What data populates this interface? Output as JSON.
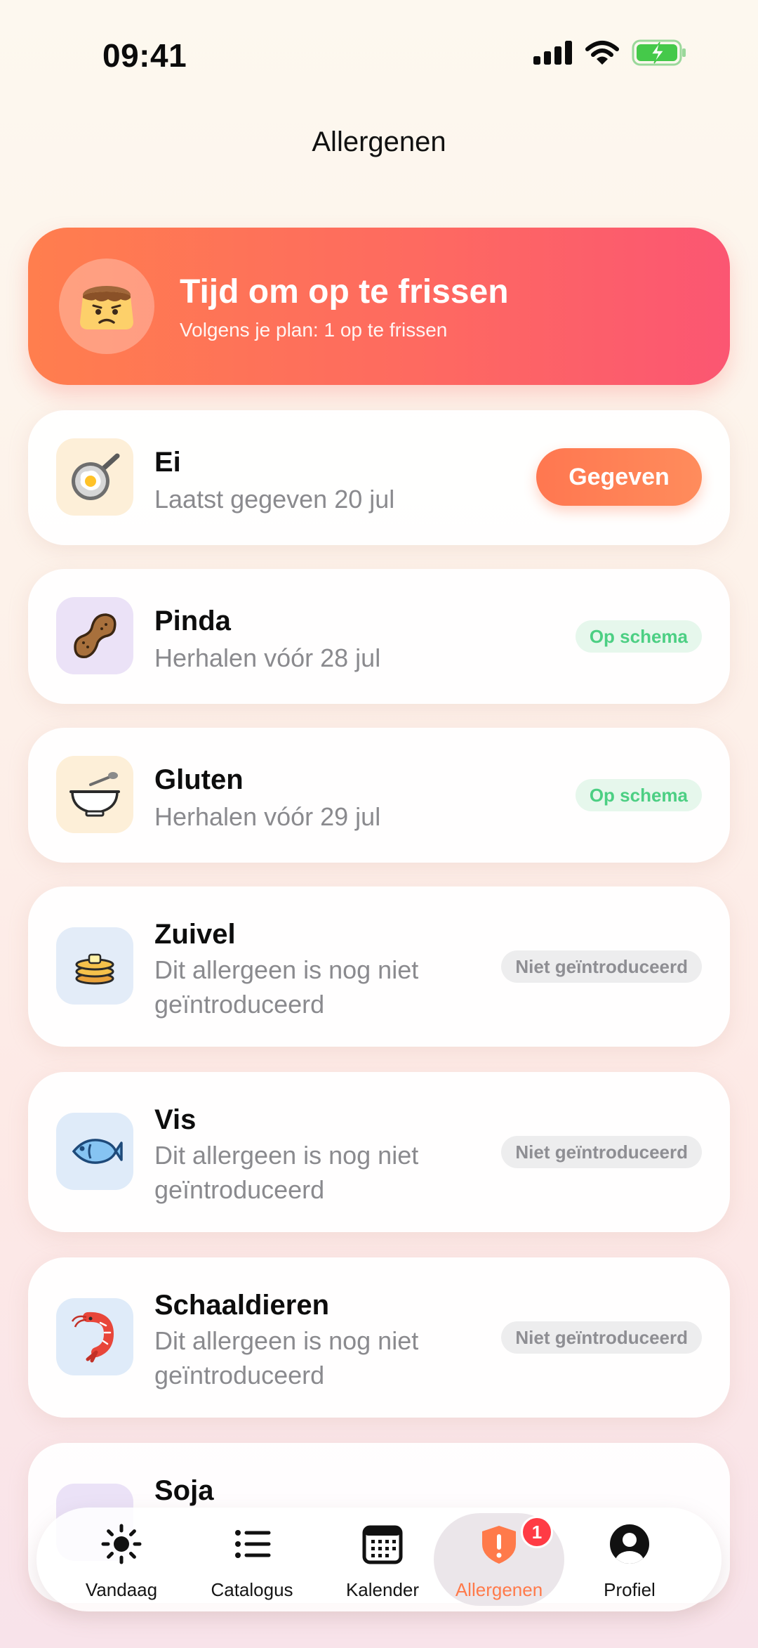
{
  "status": {
    "time": "09:41"
  },
  "header": {
    "title": "Allergenen"
  },
  "banner": {
    "title": "Tijd om op te frissen",
    "subtitle": "Volgens je plan: 1 op te frissen",
    "icon": "worried-pudding-icon"
  },
  "allergens": [
    {
      "name": "Ei",
      "subtitle": "Laatst gegeven 20 jul",
      "action_label": "Gegeven",
      "icon": "fried-egg-pan-icon"
    },
    {
      "name": "Pinda",
      "subtitle": "Herhalen vóór 28 jul",
      "status": "Op schema",
      "icon": "peanut-icon"
    },
    {
      "name": "Gluten",
      "subtitle": "Herhalen vóór 29 jul",
      "status": "Op schema",
      "icon": "cereal-bowl-icon"
    },
    {
      "name": "Zuivel",
      "subtitle": "Dit allergeen is nog niet geïntroduceerd",
      "status": "Niet geïntroduceerd",
      "icon": "pancakes-butter-icon"
    },
    {
      "name": "Vis",
      "subtitle": "Dit allergeen is nog niet geïntroduceerd",
      "status": "Niet geïntroduceerd",
      "icon": "fish-icon"
    },
    {
      "name": "Schaaldieren",
      "subtitle": "Dit allergeen is nog niet geïntroduceerd",
      "status": "Niet geïntroduceerd",
      "icon": "shrimp-icon"
    },
    {
      "name": "Soja",
      "icon": "soybean-icon"
    }
  ],
  "tabs": [
    {
      "label": "Vandaag",
      "icon": "sun-icon"
    },
    {
      "label": "Catalogus",
      "icon": "list-icon"
    },
    {
      "label": "Kalender",
      "icon": "calendar-icon"
    },
    {
      "label": "Allergenen",
      "icon": "shield-alert-icon",
      "badge": "1",
      "active": true
    },
    {
      "label": "Profiel",
      "icon": "person-icon"
    }
  ],
  "colors": {
    "accent": "#ff7a4a",
    "banner_start": "#ff7e4e",
    "banner_end": "#fb5672",
    "on_schedule": "#4ccf83",
    "not_introduced": "#8e8e93",
    "badge_red": "#ff3b45"
  }
}
